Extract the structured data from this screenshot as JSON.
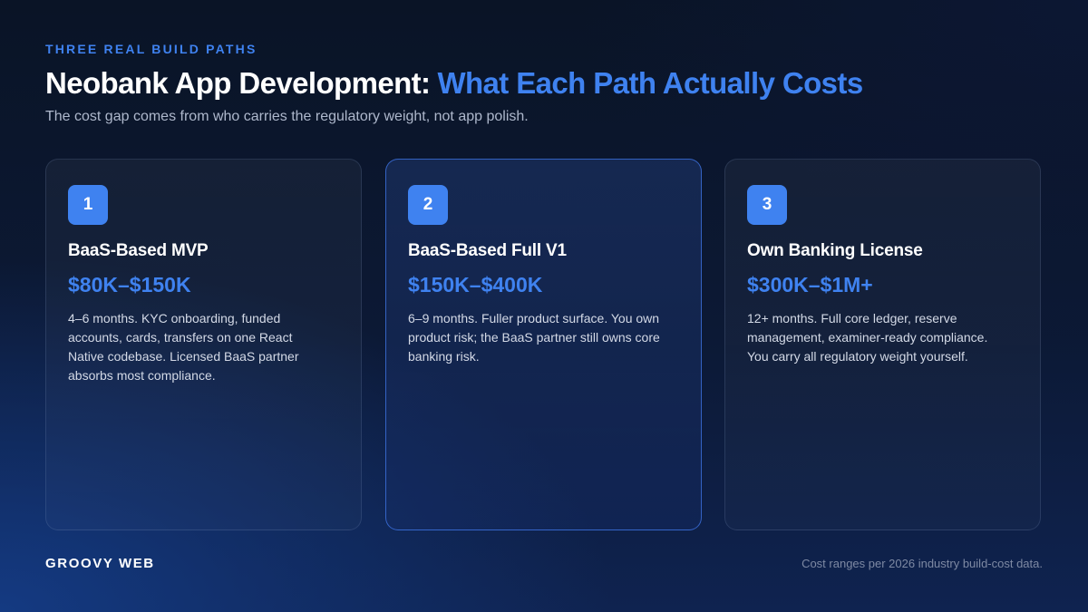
{
  "eyebrow": "THREE REAL BUILD PATHS",
  "title": {
    "main": "Neobank App Development:",
    "accent": "What Each Path Actually Costs"
  },
  "subtitle": "The cost gap comes from who carries the regulatory weight, not app polish.",
  "cards": [
    {
      "number": "1",
      "title": "BaaS-Based MVP",
      "price": "$80K–$150K",
      "description": "4–6 months. KYC onboarding, funded accounts, cards, transfers on one React Native codebase. Licensed BaaS partner absorbs most compliance."
    },
    {
      "number": "2",
      "title": "BaaS-Based Full V1",
      "price": "$150K–$400K",
      "description": "6–9 months. Fuller product surface. You own product risk; the BaaS partner still owns core banking risk.",
      "highlighted": true
    },
    {
      "number": "3",
      "title": "Own Banking License",
      "price": "$300K–$1M+",
      "description": "12+ months. Full core ledger, reserve management, examiner-ready compliance. You carry all regulatory weight yourself."
    }
  ],
  "footer": {
    "brand": "GROOVY WEB",
    "note": "Cost ranges per 2026 industry build-cost data."
  },
  "colors": {
    "accent": "#3f82f0",
    "background": "#0c1935",
    "text": "#ffffff",
    "muted": "#aeb8cc"
  }
}
